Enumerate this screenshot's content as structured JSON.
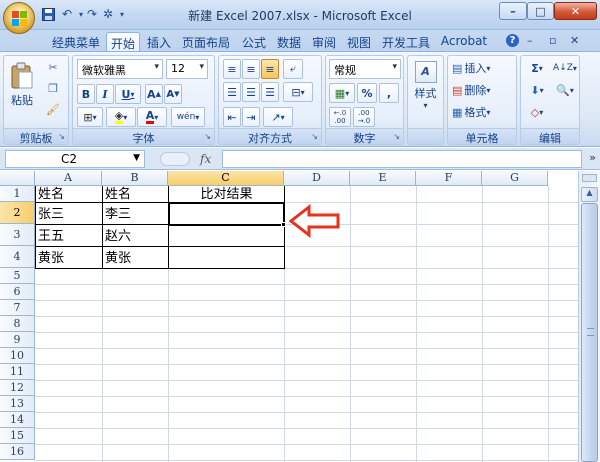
{
  "window": {
    "title": "新建 Excel 2007.xlsx - Microsoft Excel",
    "minimize": "–",
    "maximize": "□",
    "close": "✕"
  },
  "qat": {
    "save": "💾",
    "undo": "↶",
    "redo": "↷",
    "customize": "▾"
  },
  "tabs": [
    {
      "label": "经典菜单",
      "active": false
    },
    {
      "label": "开始",
      "active": true
    },
    {
      "label": "插入",
      "active": false
    },
    {
      "label": "页面布局",
      "active": false
    },
    {
      "label": "公式",
      "active": false
    },
    {
      "label": "数据",
      "active": false
    },
    {
      "label": "审阅",
      "active": false
    },
    {
      "label": "视图",
      "active": false
    },
    {
      "label": "开发工具",
      "active": false
    },
    {
      "label": "Acrobat",
      "active": false
    }
  ],
  "tab_icons": {
    "help": "?",
    "minimize": "–",
    "restore": "▫",
    "close": "✕"
  },
  "ribbon": {
    "clipboard": {
      "label": "剪贴板",
      "paste": "粘贴",
      "launcher": "↘"
    },
    "font": {
      "label": "字体",
      "font_name": "微软雅黑",
      "font_size": "12",
      "bold": "B",
      "italic": "I",
      "underline": "U",
      "grow": "A",
      "shrink": "A",
      "phonetic": "wén",
      "launcher": "↘"
    },
    "alignment": {
      "label": "对齐方式",
      "launcher": "↘"
    },
    "number": {
      "label": "数字",
      "format": "常规",
      "percent": "%",
      "comma": ",",
      "increase_decimal": "←.0\n.00",
      "decrease_decimal": ".00\n→.0",
      "launcher": "↘"
    },
    "styles": {
      "label": "样式"
    },
    "cells": {
      "label": "单元格",
      "insert": "插入",
      "delete": "删除",
      "format": "格式"
    },
    "editing": {
      "label": "编辑",
      "sum": "Σ",
      "sort": "A↓Z"
    }
  },
  "formula_bar": {
    "name_box": "C2",
    "fx": "fx",
    "expand": "»"
  },
  "columns": [
    "A",
    "B",
    "C",
    "D",
    "E",
    "F",
    "G"
  ],
  "rows": [
    "1",
    "2",
    "3",
    "4",
    "5",
    "6",
    "7",
    "8",
    "9",
    "10",
    "11",
    "12",
    "13",
    "14",
    "15",
    "16"
  ],
  "selection": {
    "column": "C",
    "row": "2"
  },
  "cells": {
    "A1": "姓名",
    "B1": "姓名",
    "C1": "比对结果",
    "A2": "张三",
    "B2": "李三",
    "A3": "王五",
    "B3": "赵六",
    "A4": "黄张",
    "B4": "黄张"
  },
  "annotation": {
    "arrow_color": "#e8321e"
  },
  "colors": {
    "selected_header": "#f7cd6b",
    "ribbon_text": "#15428b"
  }
}
